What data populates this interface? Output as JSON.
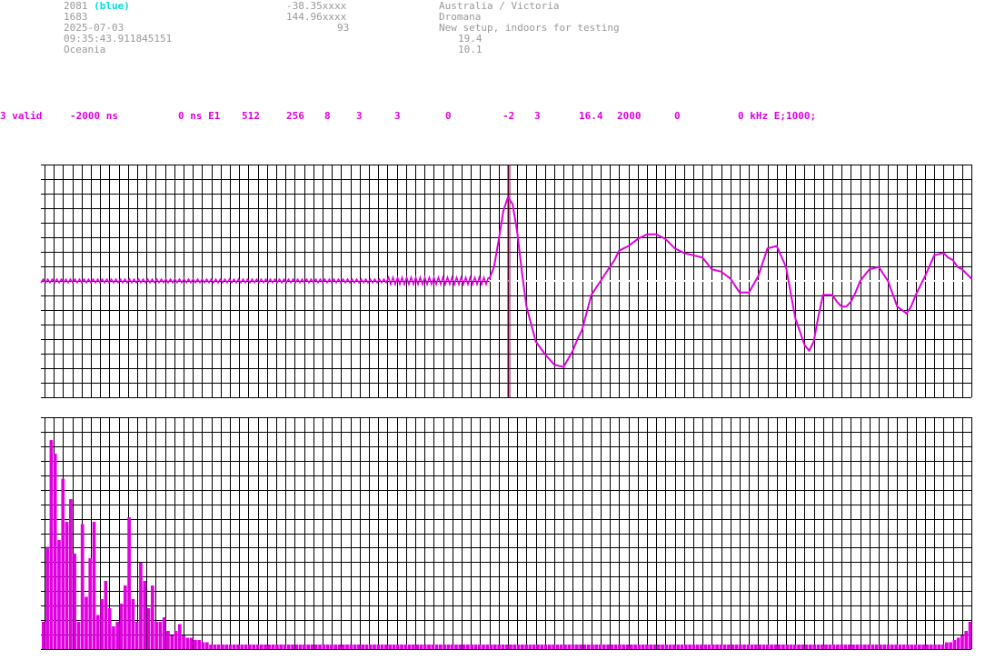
{
  "header": {
    "station_id": "2081",
    "station_color_label": "(blue)",
    "counter": "1683",
    "date": "2025-07-03",
    "time": "09:35:43.911845151",
    "region": "Oceania",
    "latitude": "-38.35xxxx",
    "longitude": "144.96xxxx",
    "value_93": "93",
    "location": "Australia / Victoria",
    "place": "Dromana",
    "note": "New setup, indoors for testing",
    "value_1": "19.4",
    "value_2": "10.1"
  },
  "params": [
    "3 valid",
    "-2000 ns",
    "0 ns E1",
    "512",
    "256",
    "8",
    "3",
    "3",
    "0",
    "-2",
    "3",
    "16.4",
    "2000",
    "0",
    "0 kHz E;1000;"
  ],
  "colors": {
    "trace": "#e000e0",
    "grid": "#000000",
    "marker": "#880044",
    "text": "#999999",
    "accent": "#00dede"
  },
  "chart_data": [
    {
      "type": "line",
      "title": "",
      "xlabel": "",
      "ylabel": "",
      "ylim": [
        -1,
        1
      ],
      "grid": true,
      "trigger_index": 0.5,
      "series": [
        {
          "name": "",
          "x": [
            0.0,
            0.37,
            0.48,
            0.485,
            0.49,
            0.495,
            0.5,
            0.505,
            0.51,
            0.515,
            0.52,
            0.53,
            0.54,
            0.55,
            0.56,
            0.57,
            0.575,
            0.58,
            0.59,
            0.6,
            0.61,
            0.615,
            0.62,
            0.63,
            0.64,
            0.65,
            0.66,
            0.67,
            0.68,
            0.69,
            0.7,
            0.71,
            0.72,
            0.73,
            0.74,
            0.75,
            0.76,
            0.77,
            0.78,
            0.79,
            0.8,
            0.81,
            0.82,
            0.825,
            0.83,
            0.835,
            0.84,
            0.85,
            0.855,
            0.86,
            0.865,
            0.87,
            0.875,
            0.88,
            0.89,
            0.9,
            0.91,
            0.92,
            0.93,
            0.935,
            0.94,
            0.95,
            0.96,
            0.97,
            0.975,
            0.98,
            0.985,
            0.99,
            1.0
          ],
          "y": [
            0.0,
            0.0,
            0.02,
            0.12,
            0.35,
            0.6,
            0.72,
            0.66,
            0.42,
            0.08,
            -0.22,
            -0.52,
            -0.63,
            -0.72,
            -0.74,
            -0.6,
            -0.5,
            -0.42,
            -0.12,
            0.0,
            0.12,
            0.18,
            0.26,
            0.3,
            0.36,
            0.4,
            0.4,
            0.36,
            0.28,
            0.24,
            0.22,
            0.2,
            0.1,
            0.08,
            0.02,
            -0.1,
            -0.1,
            0.04,
            0.28,
            0.3,
            0.12,
            -0.32,
            -0.55,
            -0.6,
            -0.52,
            -0.3,
            -0.12,
            -0.12,
            -0.18,
            -0.22,
            -0.22,
            -0.18,
            -0.1,
            0.0,
            0.1,
            0.12,
            0.0,
            -0.22,
            -0.28,
            -0.22,
            -0.12,
            0.04,
            0.22,
            0.24,
            0.2,
            0.18,
            0.12,
            0.1,
            0.02
          ]
        }
      ]
    },
    {
      "type": "bar",
      "title": "",
      "xlabel": "",
      "ylabel": "",
      "ylim": [
        0,
        1
      ],
      "grid": true,
      "series": [
        {
          "name": "",
          "values": [
            0.12,
            0.45,
            0.92,
            0.86,
            0.48,
            0.75,
            0.56,
            0.66,
            0.42,
            0.12,
            0.55,
            0.23,
            0.4,
            0.56,
            0.15,
            0.22,
            0.3,
            0.18,
            0.1,
            0.12,
            0.2,
            0.28,
            0.58,
            0.22,
            0.12,
            0.38,
            0.3,
            0.18,
            0.28,
            0.12,
            0.12,
            0.14,
            0.08,
            0.06,
            0.08,
            0.11,
            0.06,
            0.05,
            0.05,
            0.04,
            0.04,
            0.03,
            0.03,
            0.02,
            0.02,
            0.02,
            0.02,
            0.02,
            0.02,
            0.02,
            0.02,
            0.02,
            0.02,
            0.02,
            0.02,
            0.02,
            0.02,
            0.02,
            0.02,
            0.02,
            0.02,
            0.02,
            0.02,
            0.02,
            0.02,
            0.02,
            0.02,
            0.02,
            0.02,
            0.02,
            0.02,
            0.02,
            0.02,
            0.02,
            0.02,
            0.02,
            0.02,
            0.02,
            0.02,
            0.02,
            0.02,
            0.02,
            0.02,
            0.02,
            0.02,
            0.02,
            0.02,
            0.02,
            0.02,
            0.02,
            0.02,
            0.02,
            0.02,
            0.02,
            0.02,
            0.02,
            0.02,
            0.02,
            0.02,
            0.02,
            0.02,
            0.02,
            0.02,
            0.02,
            0.02,
            0.02,
            0.02,
            0.02,
            0.02,
            0.02,
            0.02,
            0.02,
            0.02,
            0.02,
            0.02,
            0.02,
            0.02,
            0.02,
            0.02,
            0.02,
            0.02,
            0.02,
            0.02,
            0.02,
            0.02,
            0.02,
            0.02,
            0.02,
            0.02,
            0.02,
            0.02,
            0.02,
            0.02,
            0.02,
            0.02,
            0.02,
            0.02,
            0.02,
            0.02,
            0.02,
            0.02,
            0.02,
            0.02,
            0.02,
            0.02,
            0.02,
            0.02,
            0.02,
            0.02,
            0.02,
            0.02,
            0.02,
            0.02,
            0.02,
            0.02,
            0.02,
            0.02,
            0.02,
            0.02,
            0.02,
            0.02,
            0.02,
            0.02,
            0.02,
            0.02,
            0.02,
            0.02,
            0.02,
            0.02,
            0.02,
            0.02,
            0.02,
            0.02,
            0.02,
            0.02,
            0.02,
            0.02,
            0.02,
            0.02,
            0.02,
            0.02,
            0.02,
            0.02,
            0.02,
            0.02,
            0.02,
            0.02,
            0.02,
            0.02,
            0.02,
            0.02,
            0.02,
            0.02,
            0.02,
            0.02,
            0.02,
            0.02,
            0.02,
            0.02,
            0.02,
            0.02,
            0.02,
            0.02,
            0.02,
            0.02,
            0.02,
            0.02,
            0.02,
            0.02,
            0.02,
            0.02,
            0.02,
            0.02,
            0.02,
            0.02,
            0.02,
            0.02,
            0.02,
            0.02,
            0.02,
            0.02,
            0.02,
            0.02,
            0.02,
            0.02,
            0.02,
            0.02,
            0.02,
            0.02,
            0.02,
            0.02,
            0.02,
            0.03,
            0.03,
            0.04,
            0.05,
            0.06,
            0.08,
            0.12
          ]
        }
      ]
    }
  ]
}
